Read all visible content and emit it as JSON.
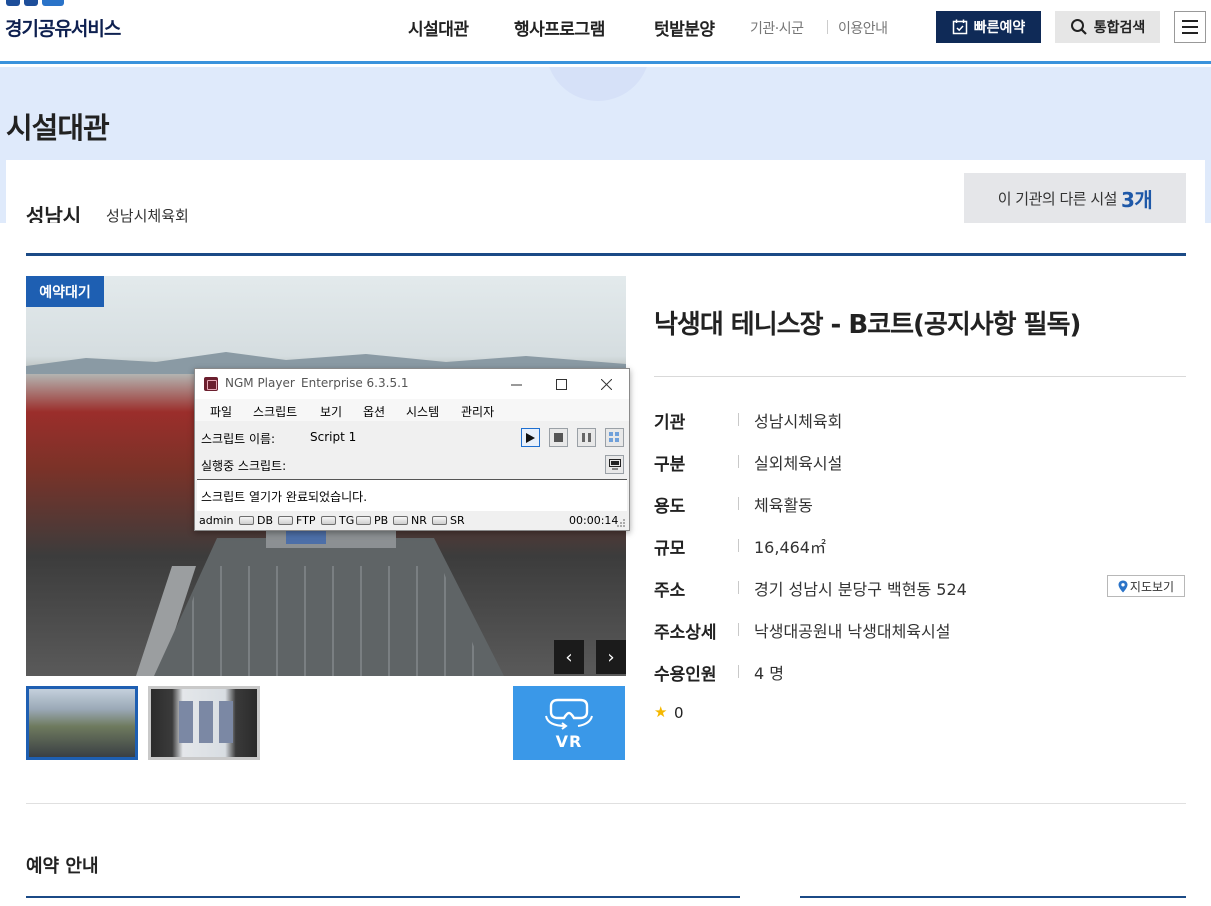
{
  "header": {
    "logo": "경기공유서비스",
    "nav": [
      "시설대관",
      "행사프로그램",
      "텃밭분양"
    ],
    "subnav": [
      "기관·시군",
      "이용안내"
    ],
    "quick_reserve": "빠른예약",
    "search": "통합검색"
  },
  "banner": {
    "title": "시설대관",
    "city": "성남시",
    "org": "성남시체육회",
    "other_label": "이 기관의 다른 시설",
    "other_count": "3개"
  },
  "photo": {
    "badge": "예약대기",
    "prev": "‹",
    "next": "›",
    "vr": "VR"
  },
  "ngm": {
    "title": "NGM Player",
    "edition": "Enterprise 6.3.5.1",
    "menu": [
      "파일",
      "스크립트",
      "보기",
      "옵션",
      "시스템",
      "관리자"
    ],
    "script_name_label": "스크립트 이름:",
    "script_name": "Script 1",
    "running_label": "실행중 스크립트:",
    "log": "스크립트 열기가 완료되었습니다.",
    "status_user": "admin",
    "status_items": [
      "DB",
      "FTP",
      "TG",
      "PB",
      "NR",
      "SR"
    ],
    "elapsed": "00:00:14"
  },
  "facility": {
    "title": "낙생대 테니스장 - B코트(공지사항 필독)",
    "rows": [
      {
        "label": "기관",
        "value": "성남시체육회"
      },
      {
        "label": "구분",
        "value": "실외체육시설"
      },
      {
        "label": "용도",
        "value": "체육활동"
      },
      {
        "label": "규모",
        "value": "16,464㎡"
      },
      {
        "label": "주소",
        "value": "경기 성남시 분당구 백현동 524"
      },
      {
        "label": "주소상세",
        "value": "낙생대공원내 낙생대체육시설"
      },
      {
        "label": "수용인원",
        "value": "4 명"
      }
    ],
    "map_button": "지도보기",
    "rating": "0"
  },
  "reservation": {
    "section_title": "예약 안내"
  },
  "colors": {
    "brand_navy": "#0f2a57",
    "accent_blue": "#1e5fb2",
    "banner_bg": "#dfeafb",
    "vr_blue": "#3a98e8"
  }
}
